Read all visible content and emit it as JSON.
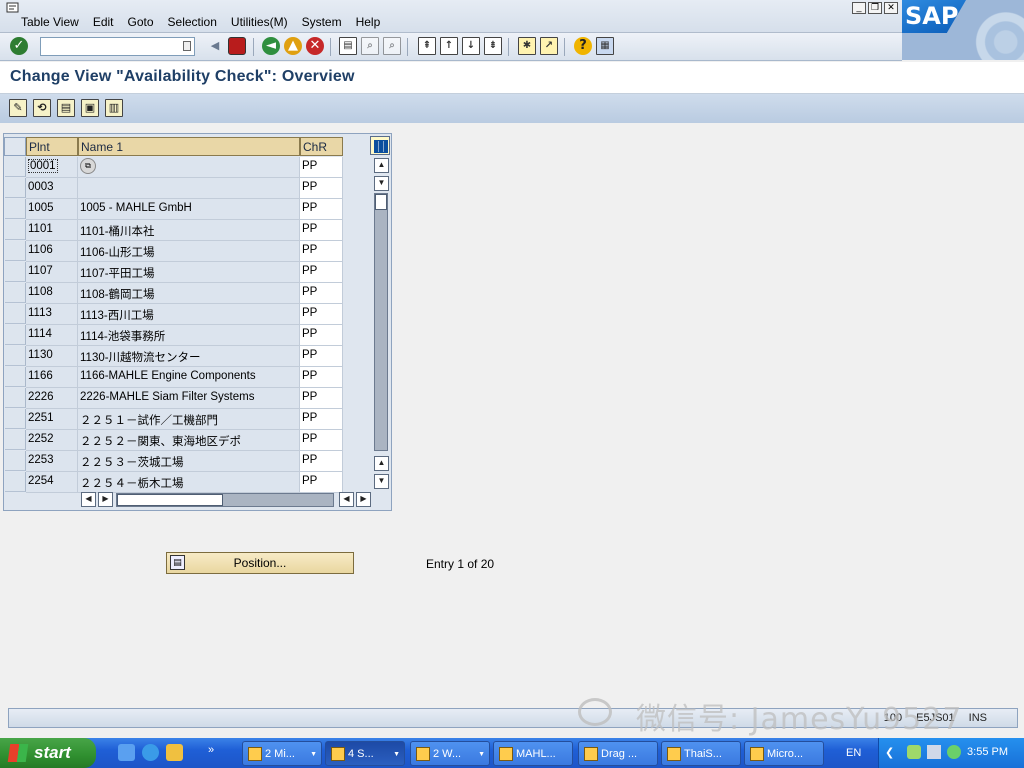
{
  "menubar": {
    "items": [
      "Table View",
      "Edit",
      "Goto",
      "Selection",
      "Utilities(M)",
      "System",
      "Help"
    ],
    "window_controls": [
      "_",
      "❐",
      "✕"
    ],
    "logo_text": "SAP"
  },
  "toolbar": {
    "command_field_value": "",
    "icons": [
      "enter-icon",
      "save-icon",
      "back-icon",
      "exit-icon",
      "cancel-icon",
      "print-icon",
      "find-icon",
      "find-next-icon",
      "first-page-icon",
      "previous-page-icon",
      "next-page-icon",
      "last-page-icon",
      "create-session-icon",
      "shortcut-icon",
      "help-icon",
      "customize-layout-icon"
    ]
  },
  "title": "Change View \"Availability Check\": Overview",
  "app_toolbar": {
    "icons": [
      "display-change-icon",
      "new-entries-icon",
      "copy-as-icon",
      "delete-icon",
      "select-all-icon"
    ]
  },
  "table": {
    "columns": [
      "Plnt",
      "Name 1",
      "ChR"
    ],
    "rows": [
      {
        "plnt": "0001",
        "name": "",
        "chr": "PP"
      },
      {
        "plnt": "0003",
        "name": "",
        "chr": "PP"
      },
      {
        "plnt": "1005",
        "name": "1005 - MAHLE GmbH",
        "chr": "PP"
      },
      {
        "plnt": "1101",
        "name": "1101-桶川本社",
        "chr": "PP"
      },
      {
        "plnt": "1106",
        "name": "1106-山形工場",
        "chr": "PP"
      },
      {
        "plnt": "1107",
        "name": "1107-平田工場",
        "chr": "PP"
      },
      {
        "plnt": "1108",
        "name": "1108-鶴岡工場",
        "chr": "PP"
      },
      {
        "plnt": "1113",
        "name": "1113-西川工場",
        "chr": "PP"
      },
      {
        "plnt": "1114",
        "name": "1114-池袋事務所",
        "chr": "PP"
      },
      {
        "plnt": "1130",
        "name": "1130-川越物流センター",
        "chr": "PP"
      },
      {
        "plnt": "1166",
        "name": "1166-MAHLE Engine Components",
        "chr": "PP"
      },
      {
        "plnt": "2226",
        "name": "2226-MAHLE Siam Filter Systems",
        "chr": "PP"
      },
      {
        "plnt": "2251",
        "name": "２２５１－試作／工機部門",
        "chr": "PP"
      },
      {
        "plnt": "2252",
        "name": "２２５２－関東、東海地区デポ",
        "chr": "PP"
      },
      {
        "plnt": "2253",
        "name": "２２５３－茨城工場",
        "chr": "PP"
      },
      {
        "plnt": "2254",
        "name": "２２５４－栃木工場",
        "chr": "PP"
      }
    ]
  },
  "position_button": {
    "label": "Position..."
  },
  "entry_info": "Entry 1 of 20",
  "statusbar": {
    "info": [
      "100",
      "E5JS01",
      "INS"
    ]
  },
  "watermark": "微信号: JamesYu9527",
  "taskbar": {
    "start_label": "start",
    "tasks": [
      {
        "label": "2 Mi...",
        "active": false
      },
      {
        "label": "4 S...",
        "active": true
      },
      {
        "label": "2 W...",
        "active": false
      },
      {
        "label": "MAHL...",
        "active": false
      },
      {
        "label": "Drag ...",
        "active": false
      },
      {
        "label": "ThaiS...",
        "active": false
      },
      {
        "label": "Micro...",
        "active": false
      }
    ],
    "language": "EN",
    "clock": "3:55 PM"
  },
  "colors": {
    "title_text": "#1f3f66",
    "column_header_bg": "#e9d7a7",
    "taskbar_blue": "#1f5fd6",
    "start_green": "#2f8f2f"
  }
}
